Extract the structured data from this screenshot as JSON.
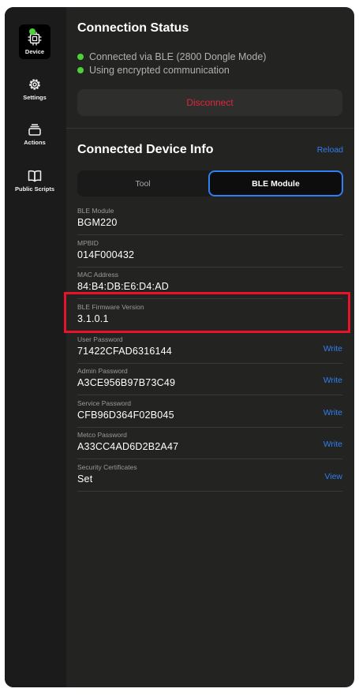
{
  "sidebar": {
    "items": [
      {
        "label": "Device",
        "icon": "chip-icon",
        "active": true
      },
      {
        "label": "Settings",
        "icon": "gear-icon",
        "active": false
      },
      {
        "label": "Actions",
        "icon": "stack-icon",
        "active": false
      },
      {
        "label": "Public Scripts",
        "icon": "book-icon",
        "active": false
      }
    ]
  },
  "connection": {
    "title": "Connection Status",
    "status_lines": [
      "Connected via BLE (2800 Dongle Mode)",
      "Using encrypted communication"
    ],
    "disconnect_label": "Disconnect"
  },
  "device_info": {
    "title": "Connected Device Info",
    "reload_label": "Reload",
    "tabs": [
      {
        "label": "Tool",
        "selected": false
      },
      {
        "label": "BLE Module",
        "selected": true
      }
    ],
    "fields": [
      {
        "label": "BLE Module",
        "value": "BGM220",
        "action": ""
      },
      {
        "label": "MPBID",
        "value": "014F000432",
        "action": ""
      },
      {
        "label": "MAC Address",
        "value": "84:B4:DB:E6:D4:AD",
        "action": ""
      },
      {
        "label": "BLE Firmware Version",
        "value": "3.1.0.1",
        "action": ""
      },
      {
        "label": "User Password",
        "value": "71422CFAD6316144",
        "action": "Write"
      },
      {
        "label": "Admin Password",
        "value": "A3CE956B97B73C49",
        "action": "Write"
      },
      {
        "label": "Service Password",
        "value": "CFB96D364F02B045",
        "action": "Write"
      },
      {
        "label": "Metco Password",
        "value": "A33CC4AD6D2B2A47",
        "action": "Write"
      },
      {
        "label": "Security Certificates",
        "value": "Set",
        "action": "View"
      }
    ]
  },
  "colors": {
    "accent": "#2f7ff2",
    "danger": "#e0263b",
    "status_ok": "#4cd137",
    "highlight": "#e8132b"
  }
}
